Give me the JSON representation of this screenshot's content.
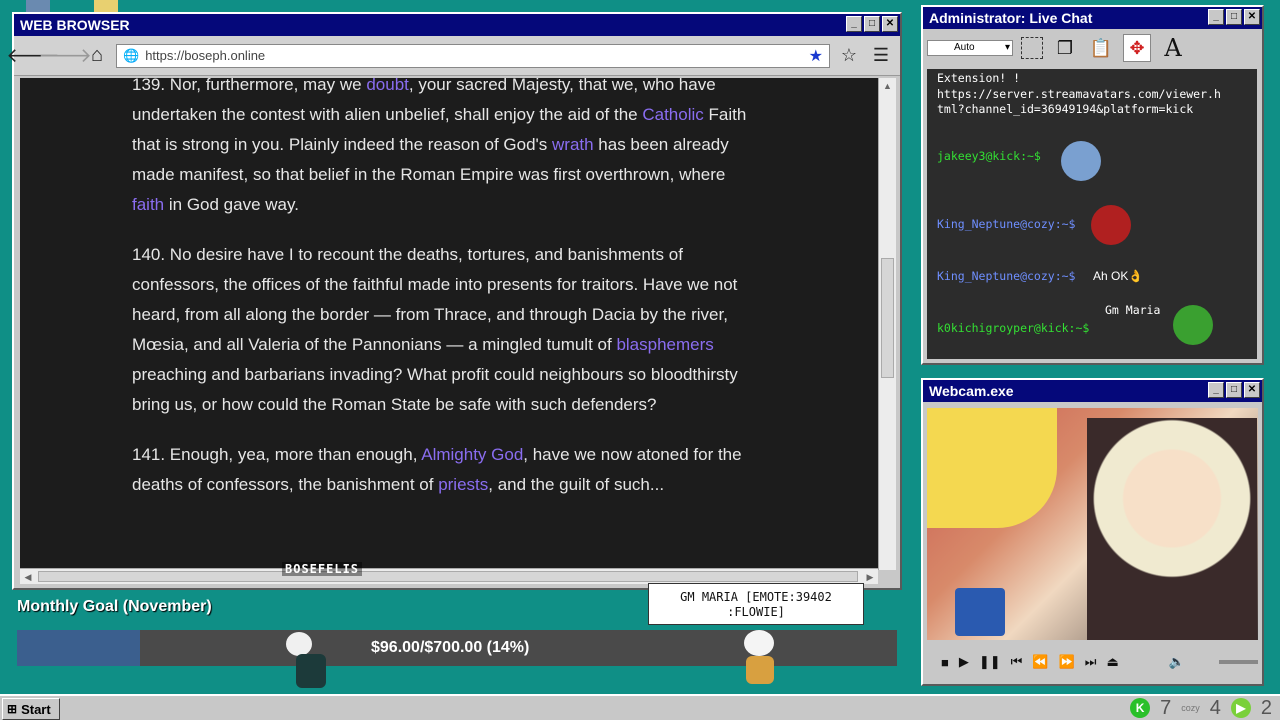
{
  "browser": {
    "title": "WEB BROWSER",
    "url": "https://boseph.online",
    "paragraphs": [
      {
        "segments": [
          {
            "t": "139. Nor, furthermore, may we "
          },
          {
            "t": "doubt",
            "link": true
          },
          {
            "t": ", your sacred Majesty, that we, who have undertaken the contest with alien unbelief, shall enjoy the aid of the "
          },
          {
            "t": "Catholic",
            "link": true
          },
          {
            "t": " Faith that is strong in you. Plainly indeed the reason of God's "
          },
          {
            "t": "wrath",
            "link": true
          },
          {
            "t": " has been already made manifest, so that belief in the Roman Empire was first overthrown, where "
          },
          {
            "t": "faith",
            "link": true
          },
          {
            "t": " in God gave way."
          }
        ]
      },
      {
        "segments": [
          {
            "t": "140. No desire have I to recount the deaths, tortures, and banishments of confessors, the offices of the faithful made into presents for traitors. Have we not heard, from all along the border — from Thrace, and through Dacia by the river, Mœsia, and all Valeria of the Pannonians — a mingled tumult of "
          },
          {
            "t": "blasphemers",
            "link": true
          },
          {
            "t": " preaching and barbarians invading? What profit could neighbours so bloodthirsty bring us, or how could the Roman State be safe with such defenders?"
          }
        ]
      },
      {
        "segments": [
          {
            "t": "141. Enough, yea, more than enough, "
          },
          {
            "t": "Almighty God",
            "link": true
          },
          {
            "t": ", have we now atoned for the deaths of confessors, the banishment of "
          },
          {
            "t": "priests",
            "link": true
          },
          {
            "t": ", and the guilt of such..."
          }
        ]
      }
    ]
  },
  "overlay_username": "BOSEFELIS",
  "chat": {
    "title": "Administrator: Live Chat",
    "combo_value": "Auto",
    "messages": [
      {
        "user": "",
        "text": "Extension! !"
      },
      {
        "user": "",
        "text": "https://server.streamavatars.com/viewer.h"
      },
      {
        "user": "",
        "text": "tml?channel_id=36949194&platform=kick"
      },
      {
        "user": "jakeey3@kick:~$",
        "text": ""
      },
      {
        "user": "King_Neptune@cozy:~$",
        "text": ""
      },
      {
        "user": "King_Neptune@cozy:~$",
        "text": "Ah OK👌"
      },
      {
        "user": "",
        "text": "Gm Maria"
      },
      {
        "user": "k0kichigroyper@kick:~$",
        "text": ""
      }
    ]
  },
  "webcam": {
    "title": "Webcam.exe"
  },
  "goal": {
    "title": "Monthly Goal (November)",
    "text": "$96.00/$700.00 (14%)",
    "progress": 0.14
  },
  "speech_bubble": "GM MARIA [EMOTE:39402\n:FLOWIE]",
  "taskbar": {
    "start_label": "Start",
    "kick_count": "7",
    "cozy_count": "4",
    "other_count": "2"
  },
  "colors": {
    "desktop": "#0f8f86",
    "titlebar": "#05087a",
    "link": "#8a6df0",
    "chat_green": "#33e033",
    "chat_blue": "#6f8fff"
  }
}
